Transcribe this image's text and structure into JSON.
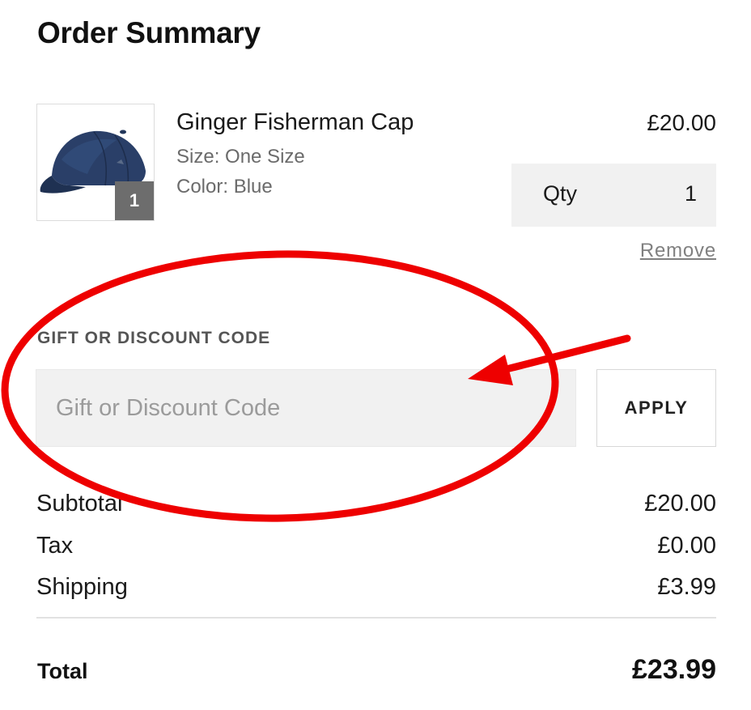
{
  "header": {
    "title": "Order Summary"
  },
  "item": {
    "name": "Ginger Fisherman Cap",
    "size": "Size: One Size",
    "color": "Color: Blue",
    "price": "£20.00",
    "thumb_quantity": "1",
    "qty_label": "Qty",
    "qty_value": "1",
    "remove_label": "Remove",
    "image_icon": "baseball-cap-icon"
  },
  "discount": {
    "label": "GIFT OR DISCOUNT CODE",
    "placeholder": "Gift or Discount Code",
    "value": "",
    "apply_label": "APPLY"
  },
  "totals": {
    "rows": [
      {
        "label": "Subtotal",
        "value": "£20.00"
      },
      {
        "label": "Tax",
        "value": "£0.00"
      },
      {
        "label": "Shipping",
        "value": "£3.99"
      }
    ],
    "total_label": "Total",
    "total_value": "£23.99"
  },
  "annotation": {
    "color": "#ee0000",
    "shapes": [
      "ellipse",
      "arrow"
    ]
  }
}
